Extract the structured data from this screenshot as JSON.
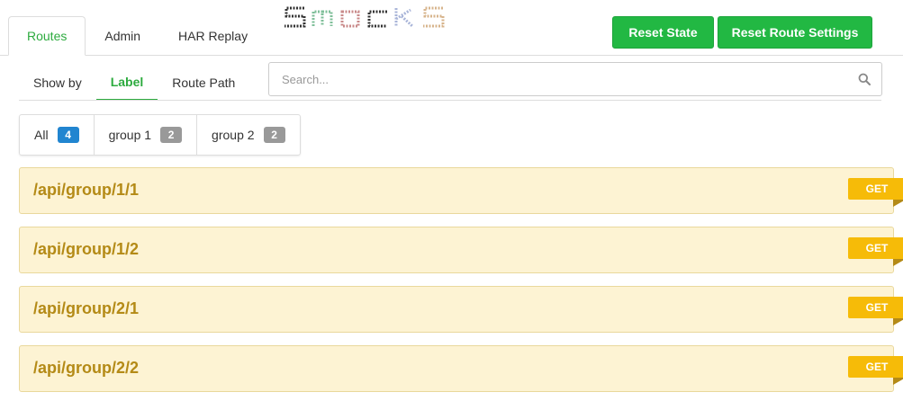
{
  "top_tabs": [
    {
      "label": "Routes",
      "active": true
    },
    {
      "label": "Admin",
      "active": false
    },
    {
      "label": "HAR Replay",
      "active": false
    }
  ],
  "logo": {
    "text": "SMOCKS"
  },
  "buttons": {
    "reset_state": "Reset State",
    "reset_route_settings": "Reset Route Settings"
  },
  "show_by": {
    "label": "Show by",
    "options": [
      {
        "label": "Label",
        "active": true
      },
      {
        "label": "Route Path",
        "active": false
      }
    ]
  },
  "search": {
    "placeholder": "Search...",
    "value": ""
  },
  "filters": [
    {
      "label": "All",
      "count": "4",
      "color": "#2185d0"
    },
    {
      "label": "group 1",
      "count": "2",
      "color": "#999999"
    },
    {
      "label": "group 2",
      "count": "2",
      "color": "#999999"
    }
  ],
  "routes": [
    {
      "path": "/api/group/1/1",
      "method": "GET"
    },
    {
      "path": "/api/group/1/2",
      "method": "GET"
    },
    {
      "path": "/api/group/2/1",
      "method": "GET"
    },
    {
      "path": "/api/group/2/2",
      "method": "GET"
    }
  ],
  "colors": {
    "accent_green": "#2dab3f",
    "button_green": "#22b843",
    "route_bg": "#fdf3d3",
    "route_text": "#b48a16",
    "method_badge": "#f6bb08"
  }
}
